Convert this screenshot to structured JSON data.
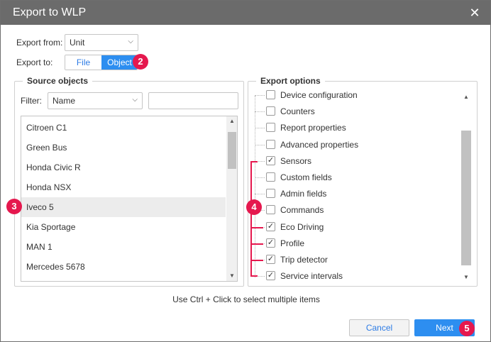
{
  "window": {
    "title": "Export to WLP",
    "close_glyph": "✕"
  },
  "export_from": {
    "label": "Export from:",
    "value": "Unit"
  },
  "export_to": {
    "label": "Export to:",
    "options": [
      "File",
      "Object"
    ],
    "selected": "Object"
  },
  "source_objects": {
    "legend": "Source objects",
    "filter_label": "Filter:",
    "filter_field": "Name",
    "search_value": "",
    "items": [
      "Citroen C1",
      "Green Bus",
      "Honda Civic R",
      "Honda NSX",
      "Iveco 5",
      "Kia Sportage",
      "MAN 1",
      "Mercedes 5678"
    ],
    "selected": "Iveco 5"
  },
  "export_options": {
    "legend": "Export options",
    "items": [
      {
        "label": "Device configuration",
        "checked": false,
        "expandable": false
      },
      {
        "label": "Counters",
        "checked": false,
        "expandable": false
      },
      {
        "label": "Report properties",
        "checked": false,
        "expandable": false
      },
      {
        "label": "Advanced properties",
        "checked": false,
        "expandable": false
      },
      {
        "label": "Sensors",
        "checked": true,
        "expandable": true
      },
      {
        "label": "Custom fields",
        "checked": false,
        "expandable": false
      },
      {
        "label": "Admin fields",
        "checked": false,
        "expandable": false
      },
      {
        "label": "Commands",
        "checked": false,
        "expandable": false
      },
      {
        "label": "Eco Driving",
        "checked": true,
        "expandable": false
      },
      {
        "label": "Profile",
        "checked": true,
        "expandable": true
      },
      {
        "label": "Trip detector",
        "checked": true,
        "expandable": false
      },
      {
        "label": "Service intervals",
        "checked": true,
        "expandable": true
      }
    ]
  },
  "hint": "Use Ctrl + Click to select multiple items",
  "buttons": {
    "cancel": "Cancel",
    "next": "Next"
  },
  "badges": {
    "b2": "2",
    "b3": "3",
    "b4": "4",
    "b5": "5"
  },
  "colors": {
    "titlebar": "#6b6b6b",
    "accent": "#2d8ef0",
    "badge": "#e5184e"
  },
  "icons": {
    "chevron": "chevron-down-icon",
    "check": "checkmark-icon"
  }
}
